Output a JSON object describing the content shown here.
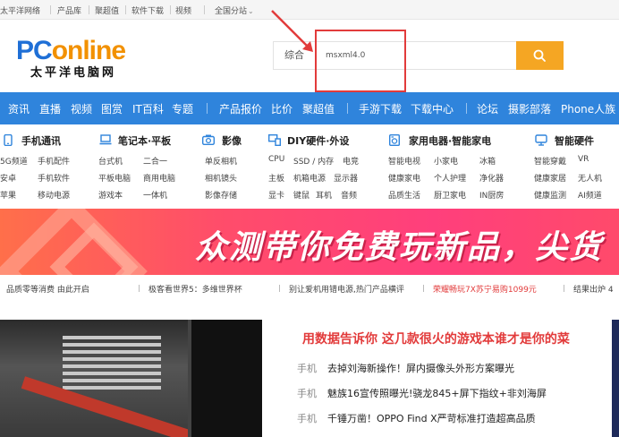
{
  "topbar": {
    "items": [
      "太平洋网络",
      "产品库",
      "聚超值",
      "软件下载",
      "视频"
    ],
    "region": "全国分站"
  },
  "logo": {
    "brand_a": "PC",
    "brand_b": "online",
    "brand_cn": "太平洋电脑网"
  },
  "search": {
    "category": "综合",
    "value": "msxml4.0"
  },
  "nav": {
    "items": [
      "资讯",
      "直播",
      "视频",
      "图赏",
      "IT百科",
      "专题",
      "产品报价",
      "比价",
      "聚超值",
      "手游下载",
      "下载中心",
      "论坛",
      "摄影部落",
      "Phone人族"
    ]
  },
  "categories": [
    {
      "title": "手机通讯",
      "icon": "phone-icon",
      "rows": [
        [
          "5G频道",
          "手机配件"
        ],
        [
          "安卓",
          "手机软件"
        ],
        [
          "苹果",
          "移动电源"
        ]
      ]
    },
    {
      "title": "笔记本·平板",
      "icon": "laptop-icon",
      "rows": [
        [
          "台式机",
          "二合一"
        ],
        [
          "平板电脑",
          "商用电脑"
        ],
        [
          "游戏本",
          "一体机"
        ]
      ]
    },
    {
      "title": "影像",
      "icon": "camera-icon",
      "rows": [
        [
          "单反相机"
        ],
        [
          "相机镜头"
        ],
        [
          "影像存储"
        ]
      ]
    },
    {
      "title": "DIY硬件·外设",
      "icon": "cpu-icon",
      "rows": [
        [
          "CPU",
          "SSD / 内存",
          "电竞"
        ],
        [
          "主板",
          "机箱电源",
          "显示器"
        ],
        [
          "显卡",
          "键鼠",
          "耳机",
          "音频"
        ]
      ]
    },
    {
      "title": "家用电器·智能家电",
      "icon": "appliance-icon",
      "rows": [
        [
          "智能电视",
          "小家电",
          "冰箱"
        ],
        [
          "健康家电",
          "个人护理",
          "净化器"
        ],
        [
          "品质生活",
          "厨卫家电",
          "IN厨房"
        ]
      ]
    },
    {
      "title": "智能硬件",
      "icon": "smart-device-icon",
      "rows": [
        [
          "智能穿戴",
          "VR"
        ],
        [
          "健康家居",
          "无人机"
        ],
        [
          "健康监测",
          "AI频道"
        ]
      ]
    }
  ],
  "banner": {
    "text": "众测带你免费玩新品，尖货"
  },
  "ticker": [
    {
      "text": "品质零等消费 由此开启",
      "highlight": false
    },
    {
      "text": "极客看世界5：多维世界杯",
      "highlight": false
    },
    {
      "text": "别让爱机用错电源,热门产品横评",
      "highlight": false
    },
    {
      "text": "荣耀畅玩7X苏宁易购1099元",
      "highlight": true
    },
    {
      "text": "结果出炉 4",
      "highlight": false
    }
  ],
  "content": {
    "headline": "用数据告诉你 这几款很火的游戏本谁才是你的菜",
    "news": [
      {
        "tag": "手机",
        "title": "去掉刘海新操作！屏内摄像头外形方案曝光"
      },
      {
        "tag": "手机",
        "title": "魅族16宣传照曝光!骁龙845+屏下指纹+非刘海屏"
      },
      {
        "tag": "手机",
        "title": "千锤万凿！OPPO Find X严苛标准打造超高品质"
      }
    ]
  },
  "colors": {
    "nav": "#2f84dc",
    "accent": "#f5a623",
    "alert": "#e23b3b",
    "brand": "#1f6fd6"
  }
}
